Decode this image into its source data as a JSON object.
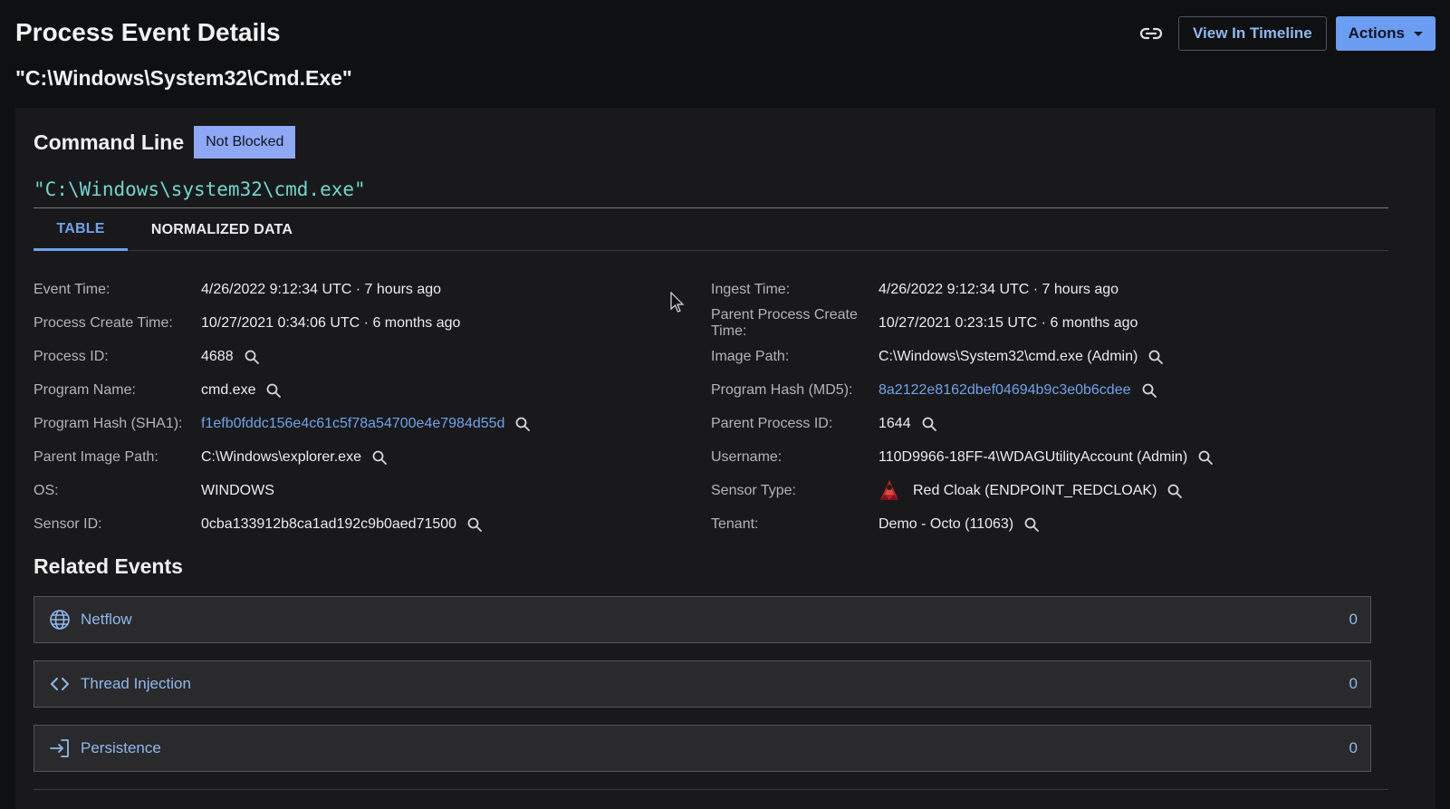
{
  "header": {
    "title": "Process Event Details",
    "subtitle": "\"C:\\Windows\\System32\\Cmd.Exe\"",
    "view_timeline_label": "View In Timeline",
    "actions_label": "Actions"
  },
  "command": {
    "title": "Command Line",
    "status_badge": "Not Blocked",
    "line": "\"C:\\Windows\\system32\\cmd.exe\""
  },
  "tabs": [
    {
      "label": "TABLE",
      "active": true
    },
    {
      "label": "NORMALIZED DATA",
      "active": false
    }
  ],
  "fields_left": [
    {
      "label": "Event Time:",
      "value": "4/26/2022 9:12:34 UTC · 7 hours ago"
    },
    {
      "label": "Process Create Time:",
      "value": "10/27/2021 0:34:06 UTC · 6 months ago"
    },
    {
      "label": "Process ID:",
      "value": "4688"
    },
    {
      "label": "Program Name:",
      "value": "cmd.exe"
    },
    {
      "label": "Program Hash (SHA1):",
      "value": "f1efb0fddc156e4c61c5f78a54700e4e7984d55d"
    },
    {
      "label": "Parent Image Path:",
      "value": "C:\\Windows\\explorer.exe"
    },
    {
      "label": "OS:",
      "value": "WINDOWS"
    },
    {
      "label": "Sensor ID:",
      "value": "0cba133912b8ca1ad192c9b0aed71500"
    }
  ],
  "fields_right": [
    {
      "label": "Ingest Time:",
      "value": "4/26/2022 9:12:34 UTC · 7 hours ago"
    },
    {
      "label": "Parent Process Create Time:",
      "value": "10/27/2021 0:23:15 UTC · 6 months ago"
    },
    {
      "label": "Image Path:",
      "value": "C:\\Windows\\System32\\cmd.exe (Admin)"
    },
    {
      "label": "Program Hash (MD5):",
      "value": "8a2122e8162dbef04694b9c3e0b6cdee"
    },
    {
      "label": "Parent Process ID:",
      "value": "1644"
    },
    {
      "label": "Username:",
      "value": "110D9966-18FF-4\\WDAGUtilityAccount (Admin)"
    },
    {
      "label": "Sensor Type:",
      "value": "Red Cloak (ENDPOINT_REDCLOAK)"
    },
    {
      "label": "Tenant:",
      "value": "Demo - Octo (11063)"
    }
  ],
  "related": {
    "title": "Related Events",
    "items": [
      {
        "label": "Netflow",
        "count": "0",
        "icon": "globe-icon"
      },
      {
        "label": "Thread Injection",
        "count": "0",
        "icon": "code-icon"
      },
      {
        "label": "Persistence",
        "count": "0",
        "icon": "login-icon"
      }
    ]
  },
  "colors": {
    "background": "#0f1012",
    "panel": "#19191b",
    "accent": "#6fa2ea",
    "command_text": "#6fd6cf",
    "badge": "#8fa8f6"
  }
}
